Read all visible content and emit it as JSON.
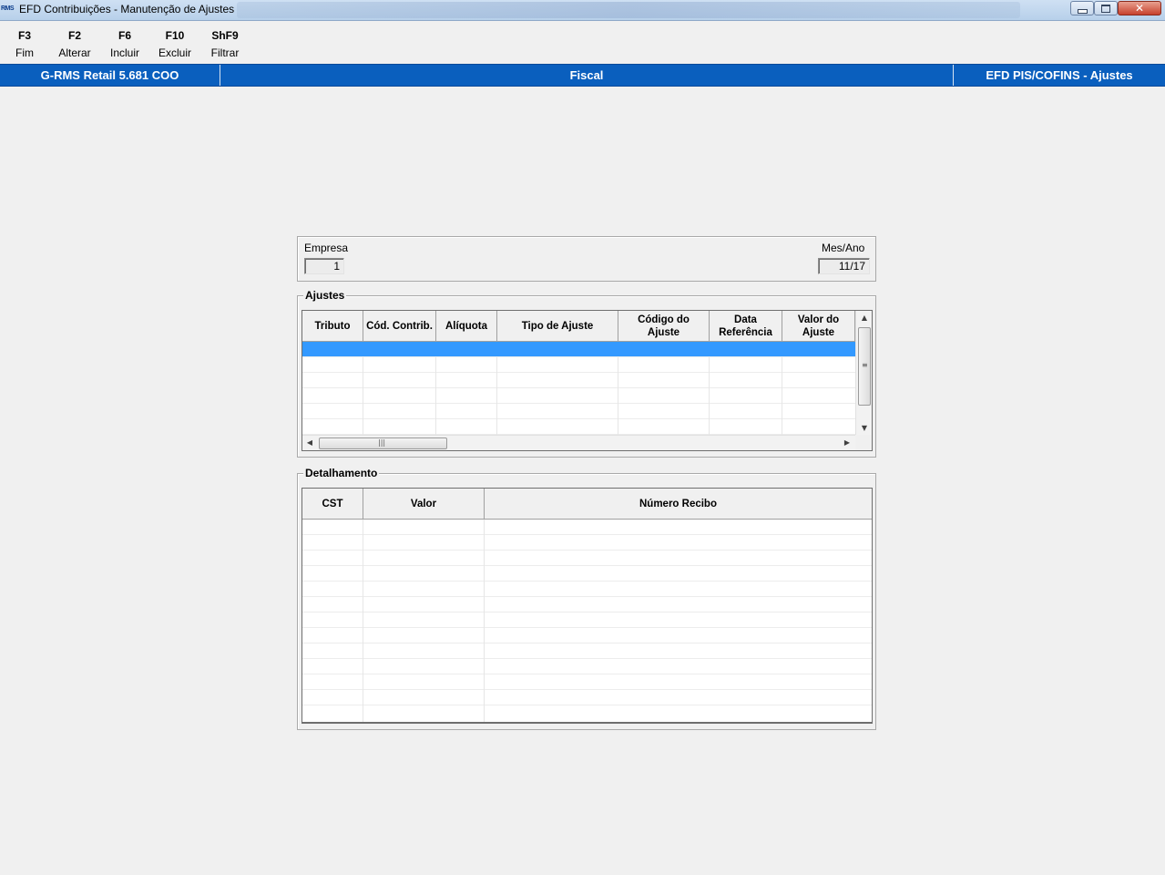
{
  "window": {
    "title": "EFD Contribuições - Manutenção de Ajustes",
    "app_icon_text": "RMS"
  },
  "toolbar": {
    "keys": [
      {
        "key": "F3",
        "label": "Fim"
      },
      {
        "key": "F2",
        "label": "Alterar"
      },
      {
        "key": "F6",
        "label": "Incluir"
      },
      {
        "key": "F10",
        "label": "Excluir"
      },
      {
        "key": "ShF9",
        "label": "Filtrar"
      }
    ]
  },
  "statusbar": {
    "left": "G-RMS Retail 5.681 COO",
    "middle": "Fiscal",
    "right": "EFD PIS/COFINS - Ajustes",
    "color": "#0a5fbe"
  },
  "filters": {
    "empresa_label": "Empresa",
    "empresa_value": "1",
    "mesano_label": "Mes/Ano",
    "mesano_value": "11/17"
  },
  "ajustes": {
    "title": "Ajustes",
    "columns": [
      "Tributo",
      "Cód. Contrib.",
      "Alíquota",
      "Tipo de Ajuste",
      "Código do Ajuste",
      "Data Referência",
      "Valor do Ajuste"
    ],
    "selected_row_color": "#3399ff"
  },
  "detalhamento": {
    "title": "Detalhamento",
    "columns": [
      "CST",
      "Valor",
      "Número Recibo"
    ]
  },
  "icons": {
    "minimize": "minimize-icon",
    "maximize": "restore-icon",
    "close": "close-icon",
    "scroll_up": "arrow-up-icon",
    "scroll_down": "arrow-down-icon",
    "scroll_left": "arrow-left-icon",
    "scroll_right": "arrow-right-icon"
  }
}
